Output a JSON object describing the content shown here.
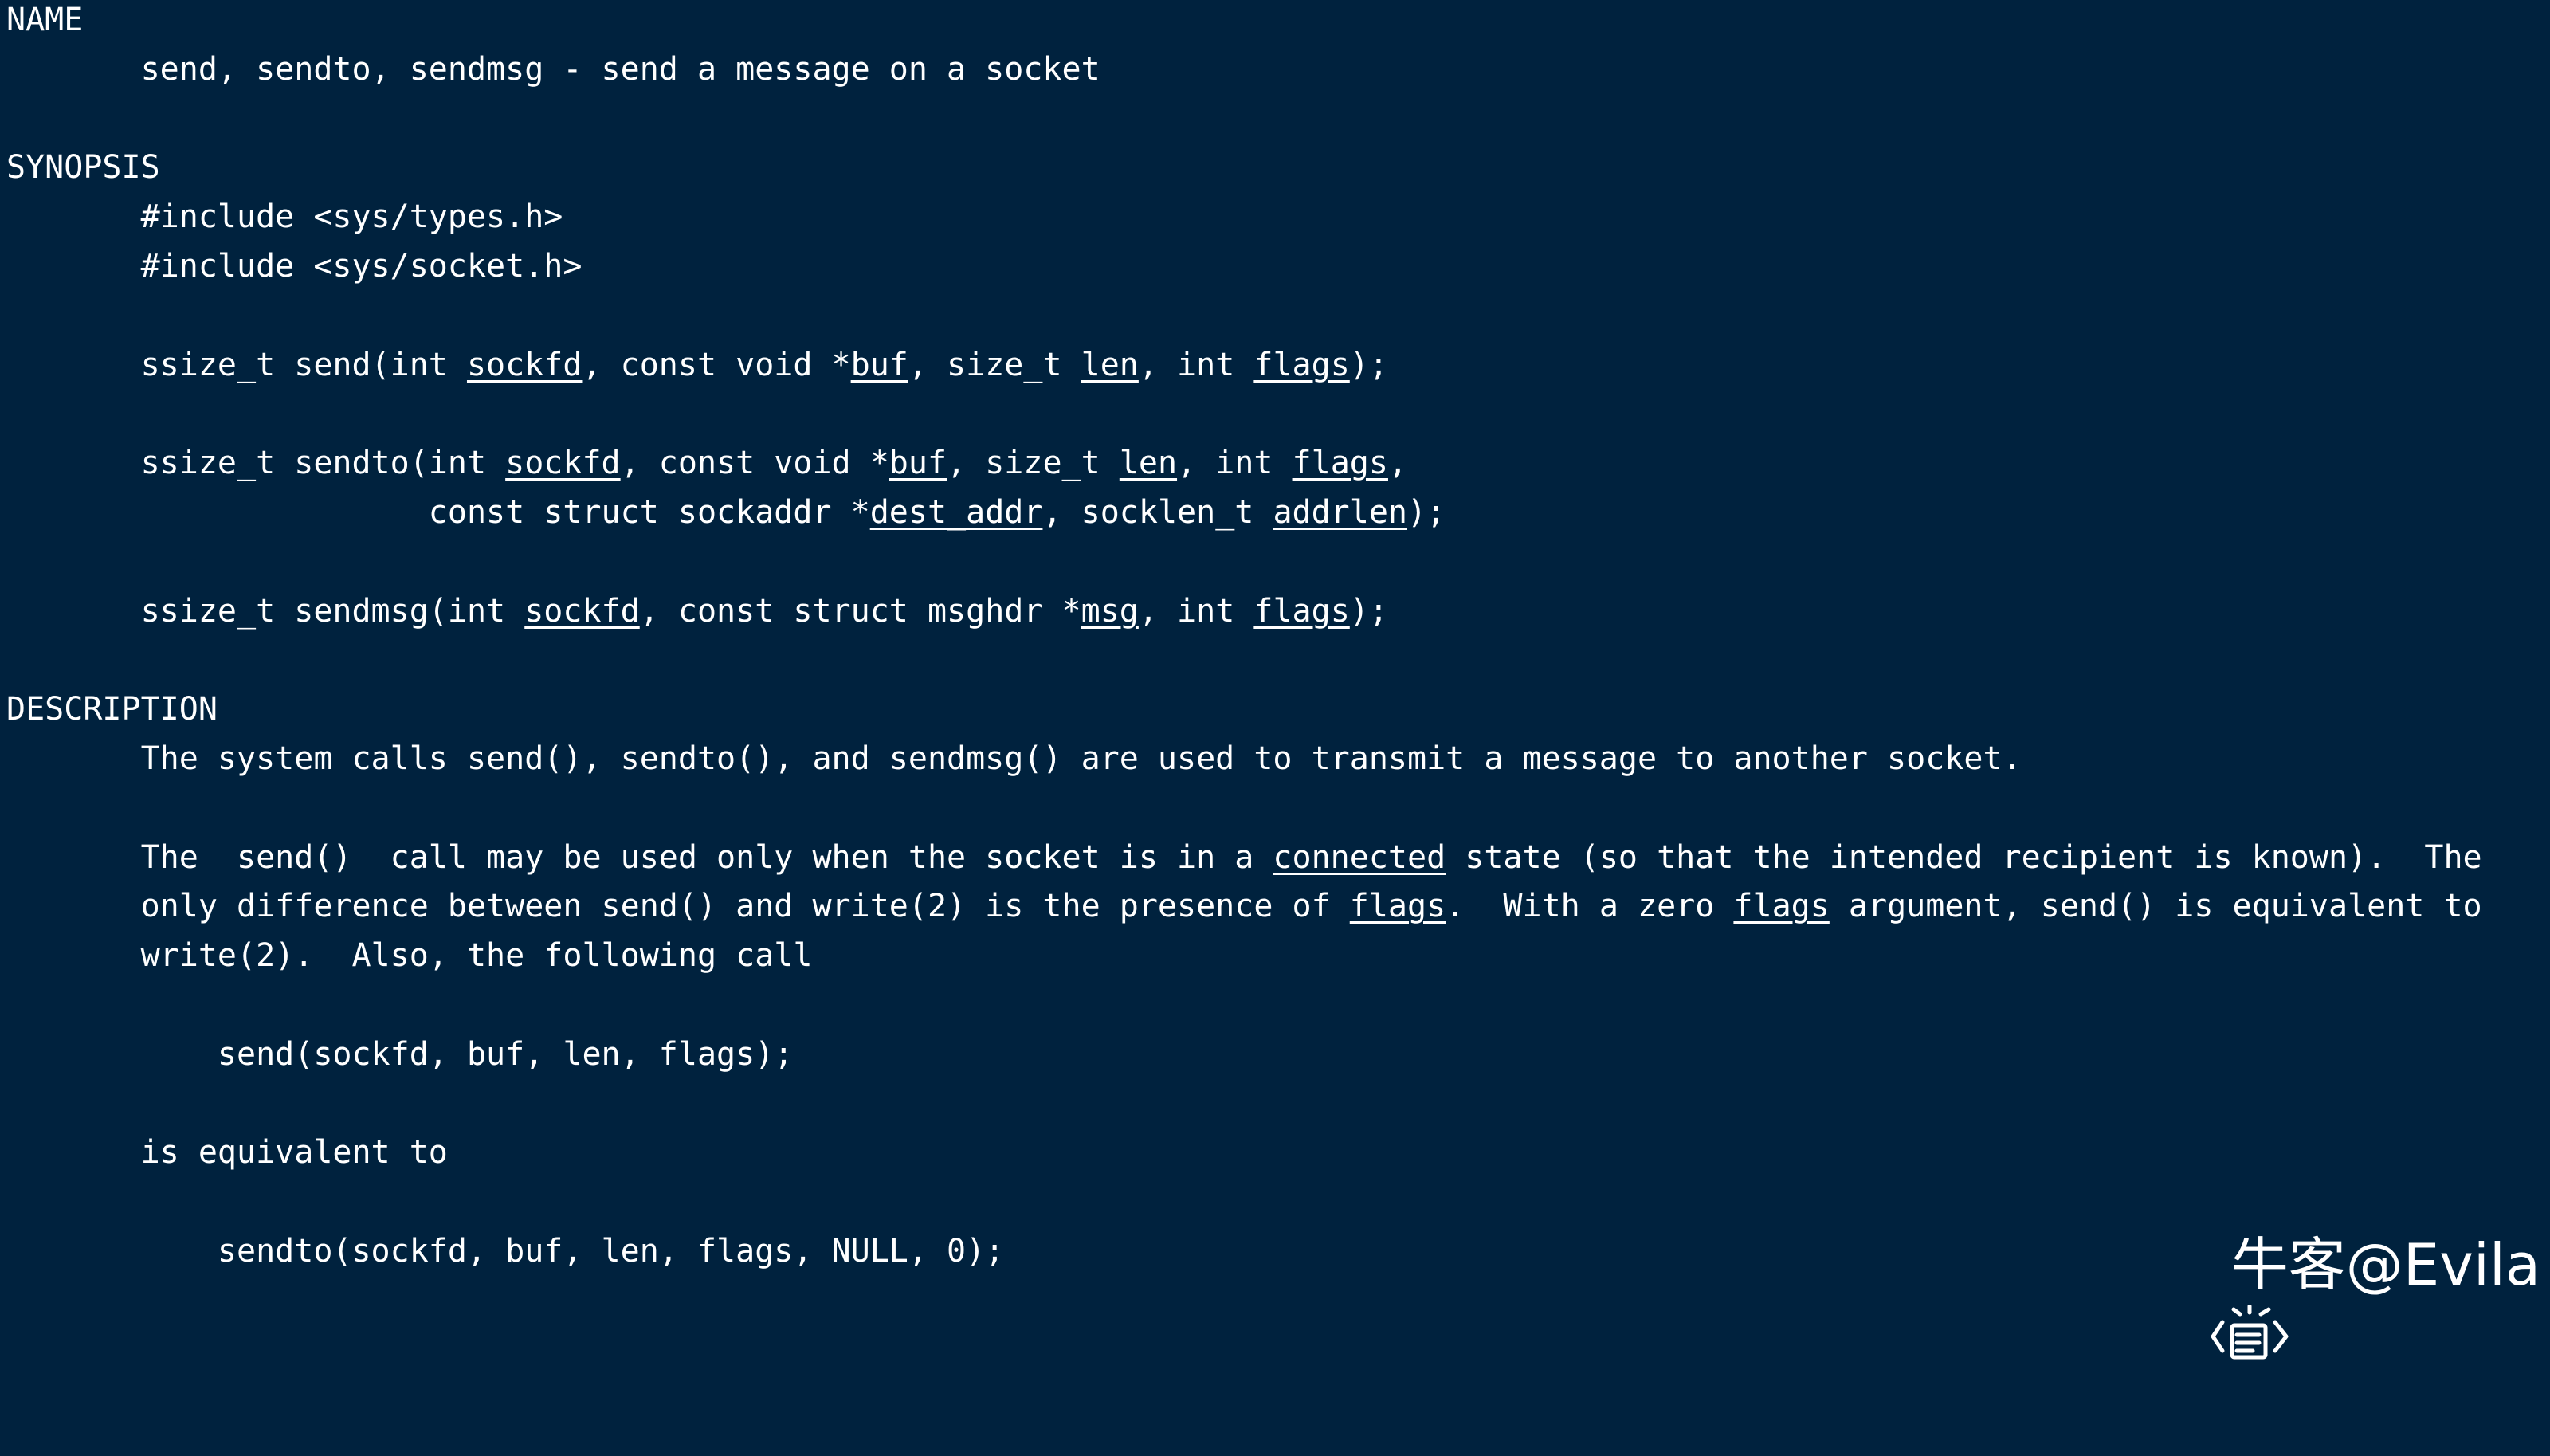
{
  "man_page": {
    "sections": [
      {
        "heading": "NAME",
        "lines": [
          [
            {
              "t": "       send, sendto, sendmsg - send a message on a socket"
            }
          ]
        ]
      },
      {
        "heading": "SYNOPSIS",
        "lines": [
          [
            {
              "t": "       #include <sys/types.h>"
            }
          ],
          [
            {
              "t": "       #include <sys/socket.h>"
            }
          ],
          [
            {
              "t": ""
            }
          ],
          [
            {
              "t": "       ssize_t send(int "
            },
            {
              "t": "sockfd",
              "u": true
            },
            {
              "t": ", const void *"
            },
            {
              "t": "buf",
              "u": true
            },
            {
              "t": ", size_t "
            },
            {
              "t": "len",
              "u": true
            },
            {
              "t": ", int "
            },
            {
              "t": "flags",
              "u": true
            },
            {
              "t": ");"
            }
          ],
          [
            {
              "t": ""
            }
          ],
          [
            {
              "t": "       ssize_t sendto(int "
            },
            {
              "t": "sockfd",
              "u": true
            },
            {
              "t": ", const void *"
            },
            {
              "t": "buf",
              "u": true
            },
            {
              "t": ", size_t "
            },
            {
              "t": "len",
              "u": true
            },
            {
              "t": ", int "
            },
            {
              "t": "flags",
              "u": true
            },
            {
              "t": ","
            }
          ],
          [
            {
              "t": "                      const struct sockaddr *"
            },
            {
              "t": "dest_addr",
              "u": true
            },
            {
              "t": ", socklen_t "
            },
            {
              "t": "addrlen",
              "u": true
            },
            {
              "t": ");"
            }
          ],
          [
            {
              "t": ""
            }
          ],
          [
            {
              "t": "       ssize_t sendmsg(int "
            },
            {
              "t": "sockfd",
              "u": true
            },
            {
              "t": ", const struct msghdr *"
            },
            {
              "t": "msg",
              "u": true
            },
            {
              "t": ", int "
            },
            {
              "t": "flags",
              "u": true
            },
            {
              "t": ");"
            }
          ]
        ]
      },
      {
        "heading": "DESCRIPTION",
        "lines": [
          [
            {
              "t": "       The system calls send(), sendto(), and sendmsg() are used to transmit a message to another socket."
            }
          ],
          [
            {
              "t": ""
            }
          ],
          [
            {
              "t": "       The  send()  call may be used only when the socket is in a "
            },
            {
              "t": "connected",
              "u": true
            },
            {
              "t": " state (so that the intended recipient is known).  The"
            }
          ],
          [
            {
              "t": "       only difference between send() and write(2) is the presence of "
            },
            {
              "t": "flags",
              "u": true
            },
            {
              "t": ".  With a zero "
            },
            {
              "t": "flags",
              "u": true
            },
            {
              "t": " argument, send() is equivalent to"
            }
          ],
          [
            {
              "t": "       write(2).  Also, the following call"
            }
          ],
          [
            {
              "t": ""
            }
          ],
          [
            {
              "t": "           send(sockfd, buf, len, flags);"
            }
          ],
          [
            {
              "t": ""
            }
          ],
          [
            {
              "t": "       is equivalent to"
            }
          ],
          [
            {
              "t": ""
            }
          ],
          [
            {
              "t": "           sendto(sockfd, buf, len, flags, NULL, 0);"
            }
          ]
        ]
      }
    ]
  },
  "watermark": {
    "text": "牛客@Evila"
  }
}
